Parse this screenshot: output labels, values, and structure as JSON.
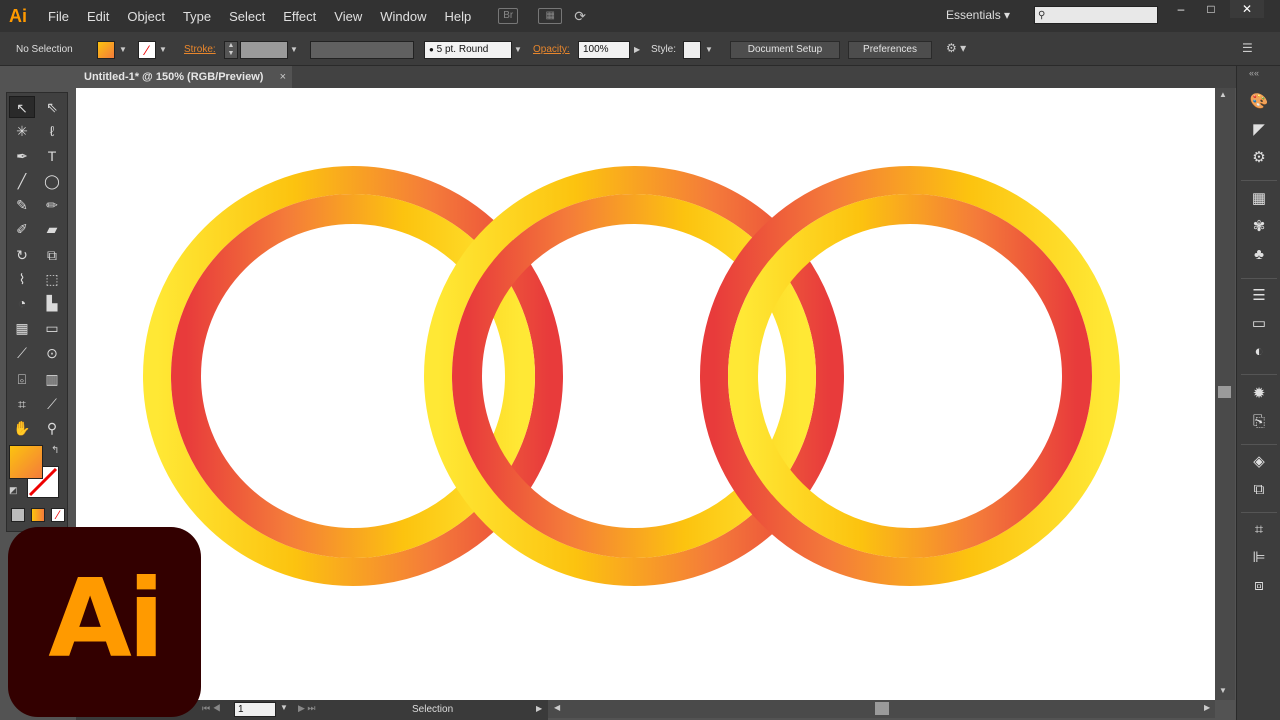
{
  "app": {
    "logo_text": "Ai"
  },
  "menu": [
    "File",
    "Edit",
    "Object",
    "Type",
    "Select",
    "Effect",
    "View",
    "Window",
    "Help"
  ],
  "menu_icons": {
    "bridge": "Br",
    "arrange": "arrange-documents-icon",
    "gpu": "gpu-preview-icon"
  },
  "workspace": "Essentials",
  "control_bar": {
    "selection_state": "No Selection",
    "fill_swatch": "#ff9a00",
    "stroke_label": "Stroke:",
    "brush_label": "5 pt. Round",
    "opacity_label": "Opacity:",
    "opacity_value": "100%",
    "style_label": "Style:",
    "document_setup": "Document Setup",
    "preferences": "Preferences"
  },
  "document_tab": {
    "title": "Untitled-1* @ 150% (RGB/Preview)",
    "close": "×"
  },
  "status_bar": {
    "zoom_value": "1",
    "current_tool": "Selection"
  },
  "badge": {
    "text": "Ai",
    "background": "#330000",
    "text_color": "#ff9a00"
  },
  "artwork": {
    "ring_gradient_colors": [
      "#e83b3b",
      "#f47b3a",
      "#fcc30f",
      "#ffe835"
    ],
    "ring_count": 3
  },
  "tools": [
    [
      "selection-tool",
      "direct-selection-tool"
    ],
    [
      "magic-wand-tool",
      "lasso-tool"
    ],
    [
      "pen-tool",
      "type-tool"
    ],
    [
      "line-segment-tool",
      "ellipse-tool"
    ],
    [
      "paintbrush-tool",
      "pencil-tool"
    ],
    [
      "blob-brush-tool",
      "eraser-tool"
    ],
    [
      "rotate-tool",
      "scale-tool"
    ],
    [
      "warp-tool",
      "free-transform-tool"
    ],
    [
      "shape-builder-tool",
      "perspective-grid-tool"
    ],
    [
      "mesh-tool",
      "gradient-tool"
    ],
    [
      "eyedropper-tool",
      "blend-tool"
    ],
    [
      "symbol-sprayer-tool",
      "column-graph-tool"
    ],
    [
      "artboard-tool",
      "slice-tool"
    ],
    [
      "hand-tool",
      "zoom-tool"
    ]
  ]
}
